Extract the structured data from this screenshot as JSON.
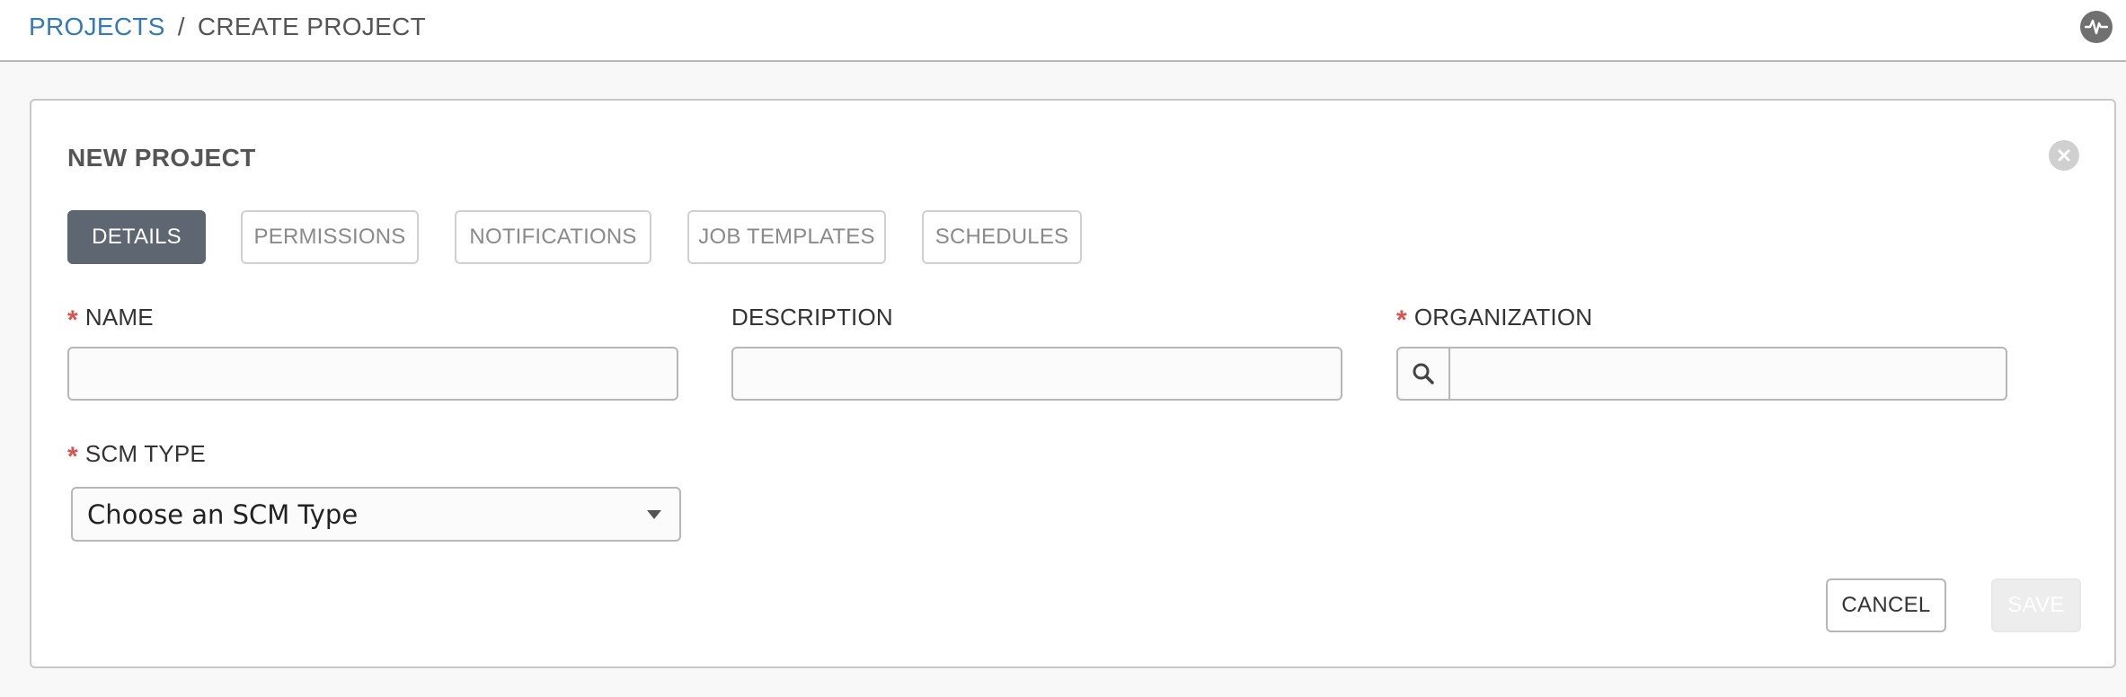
{
  "breadcrumb": {
    "parent": "PROJECTS",
    "separator": "/",
    "current": "CREATE PROJECT"
  },
  "header": {
    "activity_icon": "activity-stream-icon"
  },
  "panel": {
    "title": "NEW PROJECT",
    "close_icon": "close-circle-icon",
    "tabs": [
      {
        "label": "DETAILS",
        "active": true
      },
      {
        "label": "PERMISSIONS",
        "active": false
      },
      {
        "label": "NOTIFICATIONS",
        "active": false
      },
      {
        "label": "JOB TEMPLATES",
        "active": false
      },
      {
        "label": "SCHEDULES",
        "active": false
      }
    ]
  },
  "form": {
    "required_marker": "*",
    "name": {
      "label": "NAME",
      "required": true,
      "value": ""
    },
    "description": {
      "label": "DESCRIPTION",
      "required": false,
      "value": ""
    },
    "organization": {
      "label": "ORGANIZATION",
      "required": true,
      "value": "",
      "icon": "search-icon"
    },
    "scm_type": {
      "label": "SCM TYPE",
      "required": true,
      "selected": "Choose an SCM Type"
    }
  },
  "actions": {
    "cancel_label": "CANCEL",
    "save_label": "SAVE"
  },
  "colors": {
    "link": "#337ab7",
    "required": "#d9534f",
    "active_tab": "#5d6671"
  }
}
